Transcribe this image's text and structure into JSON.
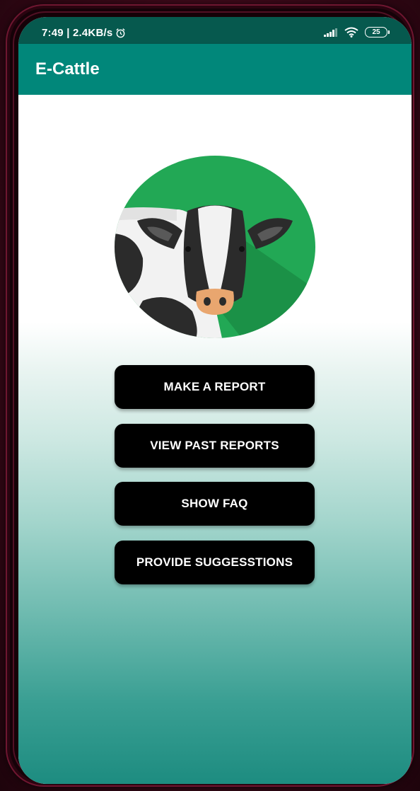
{
  "status_bar": {
    "time_speed": "7:49 | 2.4KB/s",
    "battery": "25",
    "icons": [
      "alarm-icon",
      "signal-icon",
      "wifi-icon",
      "battery-icon"
    ]
  },
  "app_bar": {
    "title": "E-Cattle"
  },
  "logo": {
    "icon": "cow-logo-icon",
    "colors": {
      "circle": "#22a855",
      "shadow": "#1b9147",
      "cow_black": "#2b2b2b",
      "cow_white": "#f2f2f2",
      "nose": "#e9a66f"
    }
  },
  "menu": {
    "make_report": "MAKE A REPORT",
    "view_past_reports": "VIEW PAST REPORTS",
    "show_faq": "SHOW FAQ",
    "provide_suggestions": "PROVIDE SUGGESSTIONS"
  },
  "colors": {
    "status_bar": "#06594e",
    "app_bar": "#01877a",
    "button": "#000000",
    "gradient_end": "#1d8c80"
  }
}
